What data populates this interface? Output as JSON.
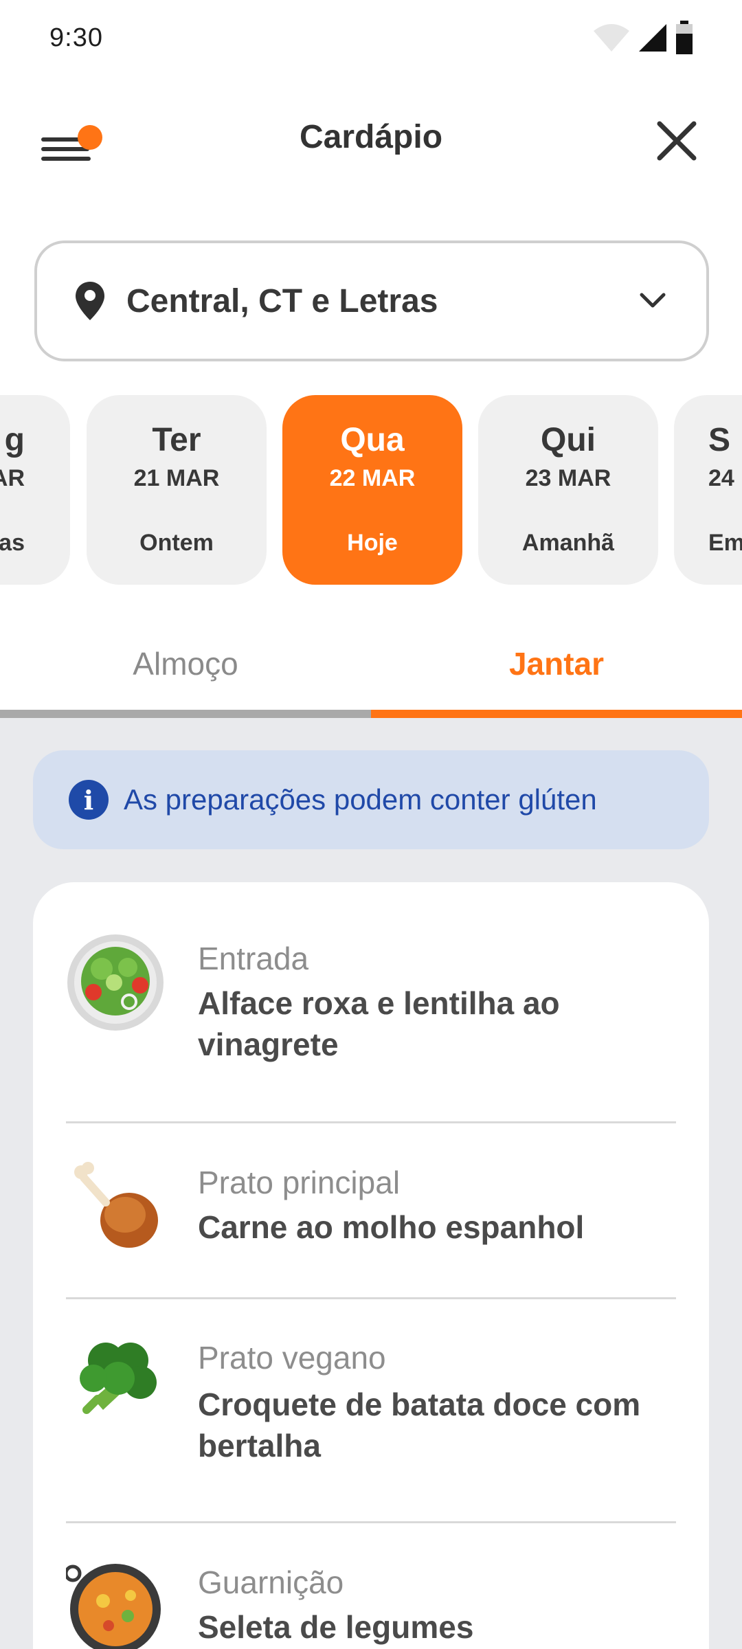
{
  "status_bar": {
    "time": "9:30"
  },
  "header": {
    "title": "Cardápio"
  },
  "location": {
    "selected": "Central, CT e Letras"
  },
  "days": [
    {
      "name": "g",
      "date": "AR",
      "relative": "lias"
    },
    {
      "name": "Ter",
      "date": "21 MAR",
      "relative": "Ontem"
    },
    {
      "name": "Qua",
      "date": "22 MAR",
      "relative": "Hoje",
      "active": true
    },
    {
      "name": "Qui",
      "date": "23 MAR",
      "relative": "Amanhã"
    },
    {
      "name": "S",
      "date": "24",
      "relative": "Em"
    }
  ],
  "meal_tabs": [
    {
      "label": "Almoço",
      "active": false
    },
    {
      "label": "Jantar",
      "active": true
    }
  ],
  "info_banner": {
    "text": "As preparações podem conter glúten"
  },
  "menu_items": [
    {
      "category": "Entrada",
      "name": "Alface roxa e lentilha ao vinagrete",
      "icon": "salad-icon"
    },
    {
      "category": "Prato principal",
      "name": "Carne ao molho espanhol",
      "icon": "poultry-leg-icon"
    },
    {
      "category": "Prato vegano",
      "name": "Croquete de batata doce com bertalha",
      "icon": "broccoli-icon"
    },
    {
      "category": "Guarnição",
      "name": "Seleta de legumes",
      "icon": "paella-pan-icon"
    }
  ],
  "colors": {
    "accent": "#ff7415",
    "info_bg": "#d5dff0",
    "info_text": "#2049a8",
    "content_bg": "#e9eaed"
  }
}
